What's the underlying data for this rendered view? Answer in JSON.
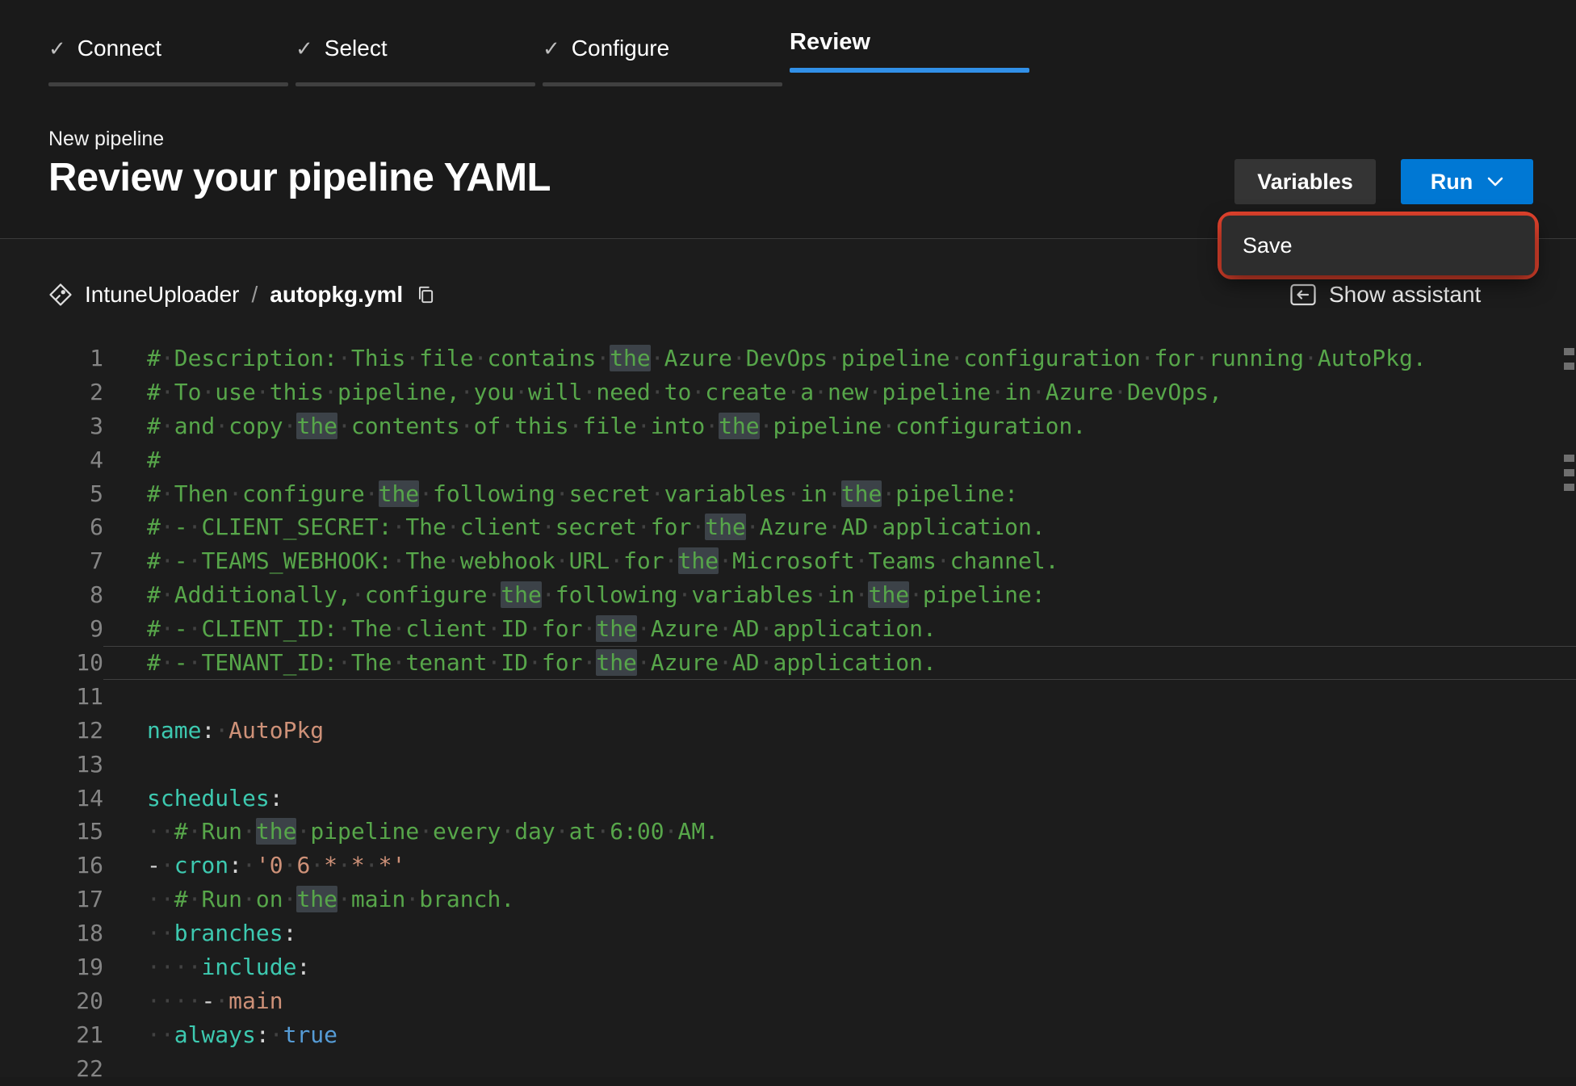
{
  "wizard": {
    "check_glyph": "✓",
    "steps": [
      {
        "label": "Connect",
        "state": "completed"
      },
      {
        "label": "Select",
        "state": "completed"
      },
      {
        "label": "Configure",
        "state": "completed"
      },
      {
        "label": "Review",
        "state": "active"
      }
    ]
  },
  "header": {
    "eyebrow": "New pipeline",
    "title": "Review your pipeline YAML",
    "variables_button": "Variables",
    "run_button": "Run"
  },
  "run_menu": {
    "save_label": "Save"
  },
  "breadcrumb": {
    "repo": "IntuneUploader",
    "separator": "/",
    "file": "autopkg.yml"
  },
  "assistant": {
    "label": "Show assistant"
  },
  "editor": {
    "highlight_word": "the",
    "current_line": 10,
    "whitespace_glyph": "·",
    "lines": [
      {
        "n": 1,
        "tokens": [
          [
            "c",
            "# Description: This file contains the Azure DevOps pipeline configuration for running AutoPkg."
          ]
        ]
      },
      {
        "n": 2,
        "tokens": [
          [
            "c",
            "# To use this pipeline, you will need to create a new pipeline in Azure DevOps,"
          ]
        ]
      },
      {
        "n": 3,
        "tokens": [
          [
            "c",
            "# and copy the contents of this file into the pipeline configuration."
          ]
        ]
      },
      {
        "n": 4,
        "tokens": [
          [
            "c",
            "#"
          ]
        ]
      },
      {
        "n": 5,
        "tokens": [
          [
            "c",
            "# Then configure the following secret variables in the pipeline:"
          ]
        ]
      },
      {
        "n": 6,
        "tokens": [
          [
            "c",
            "# - CLIENT_SECRET: The client secret for the Azure AD application."
          ]
        ]
      },
      {
        "n": 7,
        "tokens": [
          [
            "c",
            "# - TEAMS_WEBHOOK: The webhook URL for the Microsoft Teams channel."
          ]
        ]
      },
      {
        "n": 8,
        "tokens": [
          [
            "c",
            "# Additionally, configure the following variables in the pipeline:"
          ]
        ]
      },
      {
        "n": 9,
        "tokens": [
          [
            "c",
            "# - CLIENT_ID: The client ID for the Azure AD application."
          ]
        ]
      },
      {
        "n": 10,
        "tokens": [
          [
            "c",
            "# - TENANT_ID: The tenant ID for the Azure AD application."
          ]
        ]
      },
      {
        "n": 11,
        "tokens": []
      },
      {
        "n": 12,
        "tokens": [
          [
            "k",
            "name"
          ],
          [
            "p",
            ": "
          ],
          [
            "s",
            "AutoPkg"
          ]
        ]
      },
      {
        "n": 13,
        "tokens": []
      },
      {
        "n": 14,
        "tokens": [
          [
            "k",
            "schedules"
          ],
          [
            "p",
            ":"
          ]
        ]
      },
      {
        "n": 15,
        "tokens": [
          [
            "p",
            "  "
          ],
          [
            "c",
            "# Run the pipeline every day at 6:00 AM."
          ]
        ]
      },
      {
        "n": 16,
        "tokens": [
          [
            "p",
            "- "
          ],
          [
            "k",
            "cron"
          ],
          [
            "p",
            ": "
          ],
          [
            "s",
            "'0 6 * * *'"
          ]
        ]
      },
      {
        "n": 17,
        "tokens": [
          [
            "p",
            "  "
          ],
          [
            "c",
            "# Run on the main branch."
          ]
        ]
      },
      {
        "n": 18,
        "tokens": [
          [
            "p",
            "  "
          ],
          [
            "k",
            "branches"
          ],
          [
            "p",
            ":"
          ]
        ]
      },
      {
        "n": 19,
        "tokens": [
          [
            "p",
            "    "
          ],
          [
            "k",
            "include"
          ],
          [
            "p",
            ":"
          ]
        ]
      },
      {
        "n": 20,
        "tokens": [
          [
            "p",
            "    - "
          ],
          [
            "s",
            "main"
          ]
        ]
      },
      {
        "n": 21,
        "tokens": [
          [
            "p",
            "  "
          ],
          [
            "k",
            "always"
          ],
          [
            "p",
            ": "
          ],
          [
            "b",
            "true"
          ]
        ]
      },
      {
        "n": 22,
        "tokens": []
      }
    ],
    "ruler_marks": [
      8,
      26,
      140,
      158,
      176
    ]
  },
  "colors": {
    "accent_blue": "#3190e8",
    "run_button_blue": "#0078d4",
    "annotation_red": "#e8442e",
    "comment_green": "#57a64a",
    "key_teal": "#3dc9b0",
    "string_orange": "#ce9178",
    "bool_blue": "#569cd6"
  }
}
